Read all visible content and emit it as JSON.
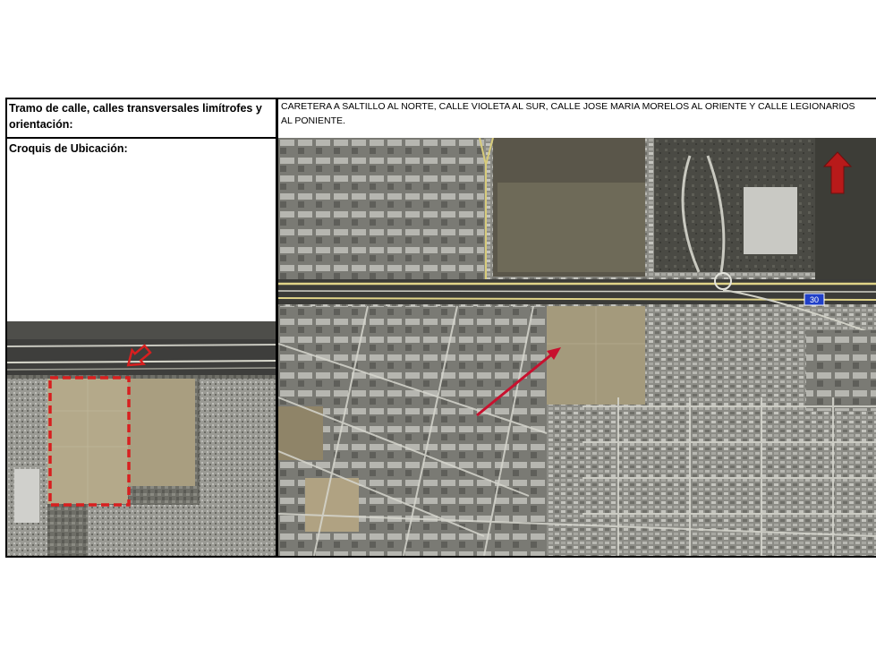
{
  "row1": {
    "label": "Tramo de calle, calles transversales limítrofes y orientación:",
    "value": "CARETERA A SALTILLO AL NORTE, CALLE VIOLETA AL SUR, CALLE JOSE MARIA MORELOS AL ORIENTE Y CALLE LEGIONARIOS AL PONIENTE."
  },
  "row2": {
    "label": "Croquis de Ubicación:"
  },
  "detail_map": {
    "highlight_color": "#d81f1f",
    "marker_icon": "outline-arrow-icon"
  },
  "overview_map": {
    "highway_shield": "30",
    "pointer_color": "#c8102e",
    "north_arrow_color": "#b81a1a",
    "north_icon": "north-arrow-icon"
  }
}
